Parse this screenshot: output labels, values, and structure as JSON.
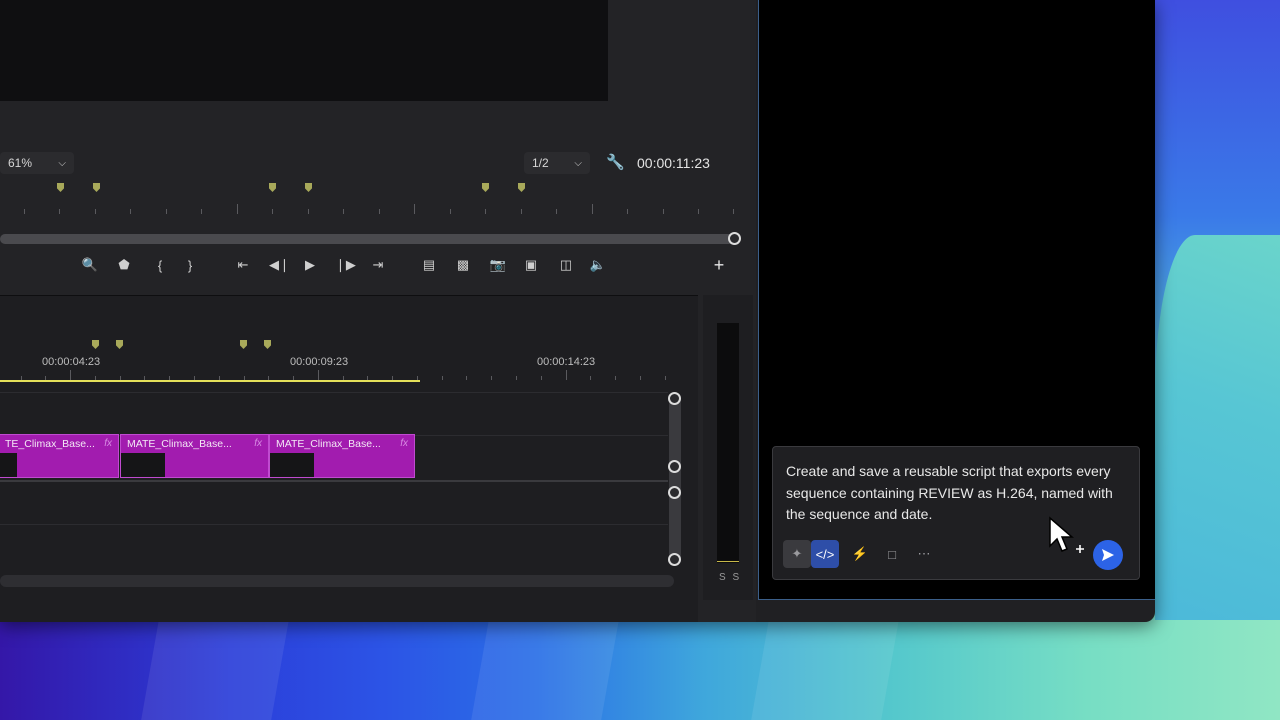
{
  "monitor": {
    "zoom_value": "61%",
    "resolution_value": "1/2",
    "timecode": "00:00:11:23"
  },
  "timeline": {
    "ruler_times": [
      "00:00:04:23",
      "00:00:09:23",
      "00:00:14:23"
    ],
    "clips": [
      {
        "label": "TE_Climax_Base...",
        "fx": "fx"
      },
      {
        "label": "MATE_Climax_Base...",
        "fx": "fx"
      },
      {
        "label": "MATE_Climax_Base...",
        "fx": "fx"
      }
    ]
  },
  "meter": {
    "labels": "S S"
  },
  "assistant": {
    "prompt": "Create and save a reusable script that exports every sequence containing REVIEW as H.264, named with the sequence and date."
  },
  "colors": {
    "clip": "#a21caf",
    "accent": "#2c63e6",
    "marker": "#a8a95a",
    "playhead_range": "#e4e05a"
  }
}
